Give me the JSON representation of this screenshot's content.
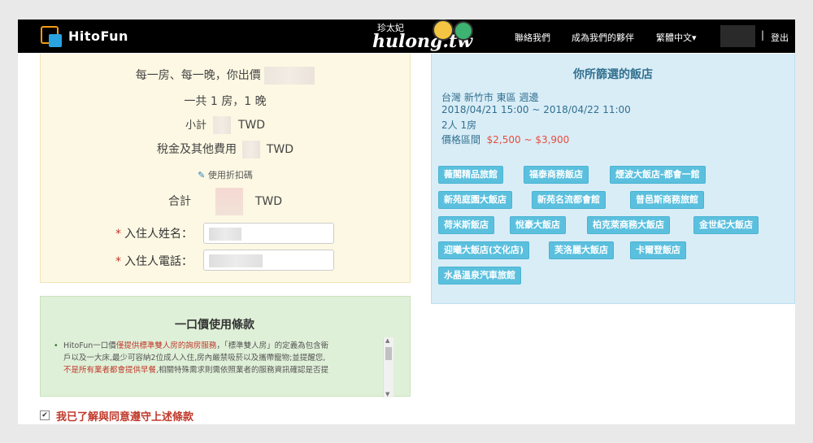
{
  "navbar": {
    "brand": "HitoFun",
    "watermark_top": "珍太妃",
    "watermark_main": "hulong.tw",
    "links": [
      "聯絡我們",
      "成為我們的夥伴",
      "繁體中文▾"
    ],
    "separator": "|",
    "logout": "登出"
  },
  "booking": {
    "offer_text": "每一房、每一晚，你出價",
    "rooms_nights": "一共 1 房，1 晚",
    "subtotal_label": "小計",
    "currency": "TWD",
    "tax_label": "稅金及其他費用",
    "discount_link": "使用折扣碼",
    "total_label": "合計",
    "guest_name_label": "入住人姓名：",
    "guest_phone_label": "入住人電話：",
    "required_mark": "*"
  },
  "selected": {
    "title": "你所篩選的飯店",
    "location": "台灣  新竹市  東區 週邊",
    "dates": "2018/04/21 15:00  ~  2018/04/22 11:00",
    "guests": "2人  1房",
    "price_label": "價格區間",
    "price_range": "$2,500 ~  $3,900",
    "hotels": [
      "薇閣精品旅館",
      "福泰商務飯店",
      "煙波大飯店-都會一館",
      "新苑庭園大飯店",
      "新苑名流都會館",
      "普邑斯商務旅館",
      "荷米斯飯店",
      "悅豪大飯店",
      "柏克萊商務大飯店",
      "金世紀大飯店",
      "迎曦大飯店(文化店)",
      "芙洛麗大飯店",
      "卡爾登飯店",
      "水晶溫泉汽車旅館"
    ]
  },
  "terms": {
    "title": "一口價使用條款",
    "line1_a": "HitoFun一口價",
    "line1_b": "僅提供標準雙人房的詢房服務",
    "line1_c": "，「標準雙人房」的定義為包含衛",
    "line2": "戶以及一大床,最少可容納2位成人入住,房內嚴禁吸菸以及攜帶寵物;並提醒您,",
    "line3_a": "不是所有業者都會提供早餐",
    "line3_b": ",相關特殊需求則需依照業者的服務資訊確認是否提",
    "agree_text": "我已了解與同意遵守上述條款",
    "checkbox_mark": "✔"
  },
  "colors": {
    "accent_blue": "#5bc0de",
    "price_red": "#e74c3c",
    "warning_bg": "#fcf8e3",
    "info_bg": "#d9edf7",
    "success_bg": "#dff0d8"
  }
}
